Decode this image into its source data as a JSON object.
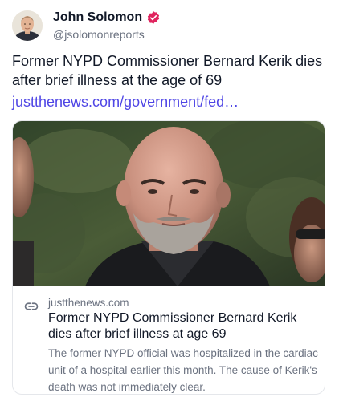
{
  "author": {
    "name": "John Solomon",
    "handle": "@jsolomonreports",
    "verified_color": "#e0245e"
  },
  "post": {
    "text": "Former NYPD Commissioner Bernard Kerik dies after brief illness at the age of 69",
    "link_text": "justthenews.com/government/fed…",
    "link_color": "#4f46e5"
  },
  "card": {
    "domain": "justthenews.com",
    "title": "Former NYPD Commissioner Bernard Kerik dies after brief illness at age 69",
    "description": "The former NYPD official was hospitalized in the cardiac unit of a hospital earlier this month. The cause of Kerik's death was not immediately clear."
  }
}
